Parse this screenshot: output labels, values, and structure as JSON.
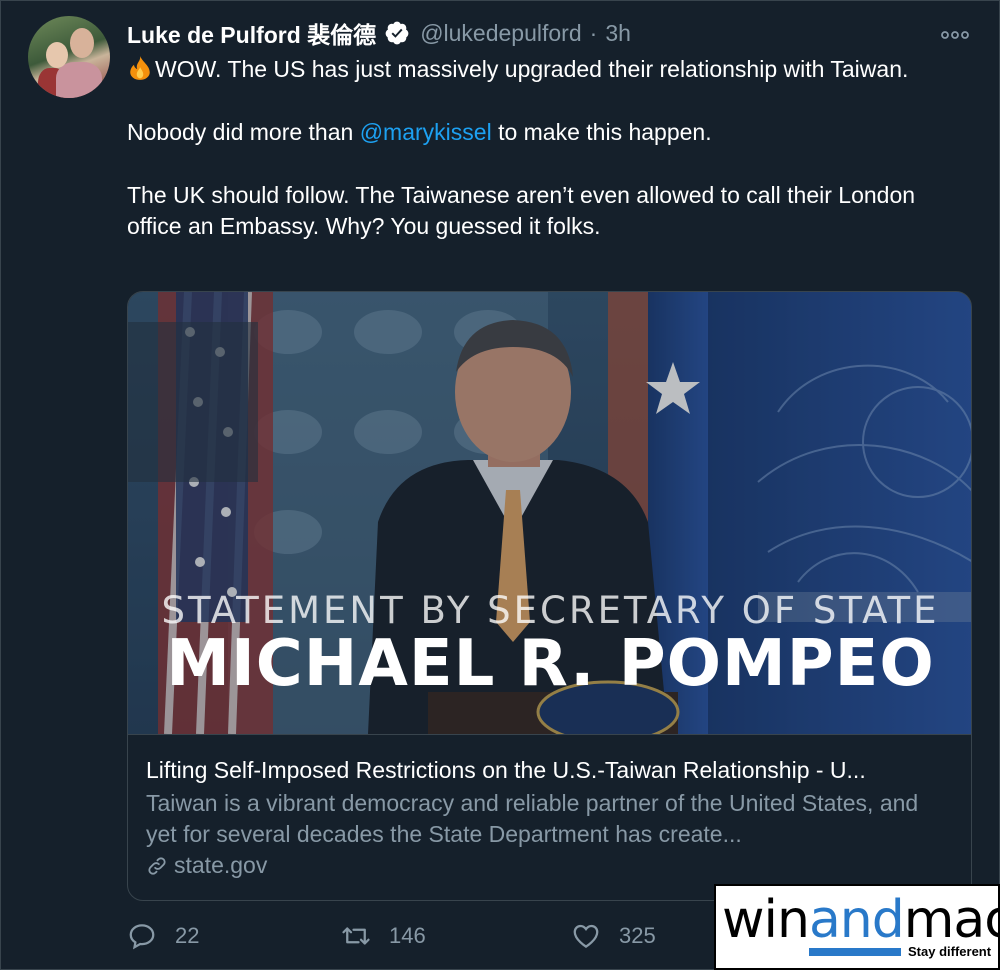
{
  "author": {
    "name": "Luke de Pulford 裴倫德",
    "handle": "@lukedepulford",
    "separator": "·",
    "time": "3h",
    "verified": true
  },
  "tweet": {
    "line1_text": "WOW. The US has just massively upgraded their relationship with Taiwan.",
    "line2_before": "Nobody did more than ",
    "line2_mention": "@marykissel",
    "line2_after": " to make this happen.",
    "line3_text": "The UK should follow. The Taiwanese aren’t even allowed to call their London office an Embassy. Why? You guessed it folks.",
    "emoji": "fire-icon"
  },
  "card": {
    "image_subtitle": "STATEMENT BY SECRETARY OF STATE",
    "image_title": "MICHAEL R. POMPEO",
    "title": "Lifting Self-Imposed Restrictions on the U.S.-Taiwan Relationship - U...",
    "description": "Taiwan is a vibrant democracy and reliable partner of the United States, and yet for several decades the State Department has create...",
    "domain": "state.gov"
  },
  "actions": {
    "reply_count": "22",
    "retweet_count": "146",
    "like_count": "325"
  },
  "watermark": {
    "part1": "win",
    "part2": "and",
    "part3": "mac",
    "tagline": "Stay different"
  },
  "colors": {
    "background": "#15202b",
    "accent": "#1da1f2",
    "secondary_text": "#8899a6",
    "border": "#38444d"
  }
}
